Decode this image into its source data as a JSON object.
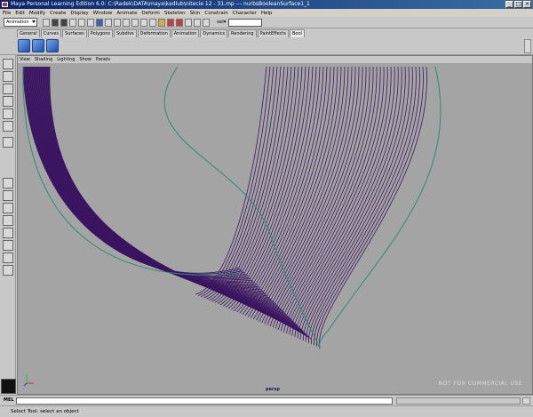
{
  "window": {
    "title": "Maya Personal Learning Edition 6.0: C:\\Radek\\DATA\\maya\\kadlub\\nitecie 12 - 31.mp  ---  nurbsBooleanSurface1_1"
  },
  "menubar": {
    "items": [
      "File",
      "Edit",
      "Modify",
      "Create",
      "Display",
      "Window",
      "Animate",
      "Deform",
      "Skeleton",
      "Skin",
      "Constrain",
      "Character",
      "Help"
    ]
  },
  "statusline": {
    "mode": "Animation",
    "sel_label": "sel▾",
    "sel_value": ""
  },
  "shelf": {
    "tabs": [
      "General",
      "Curves",
      "Surfaces",
      "Polygons",
      "Subdivs",
      "Deformation",
      "Animation",
      "Dynamics",
      "Rendering",
      "PaintEffects",
      "Bool"
    ],
    "active_tab": "Bool",
    "icon_count_label": ""
  },
  "viewport": {
    "menu": [
      "View",
      "Shading",
      "Lighting",
      "Show",
      "Panels"
    ],
    "camera": "persp",
    "curve_color": "#3b1560",
    "edge_color": "#2e8b7a",
    "background": "#a4a4a4"
  },
  "watermark": "NOT FOR COMMERCIAL USE",
  "helpline": {
    "text": "Select Tool: select an object"
  },
  "colors": {
    "ui_gray": "#c8c8c8",
    "title_blue": "#0a246a"
  }
}
